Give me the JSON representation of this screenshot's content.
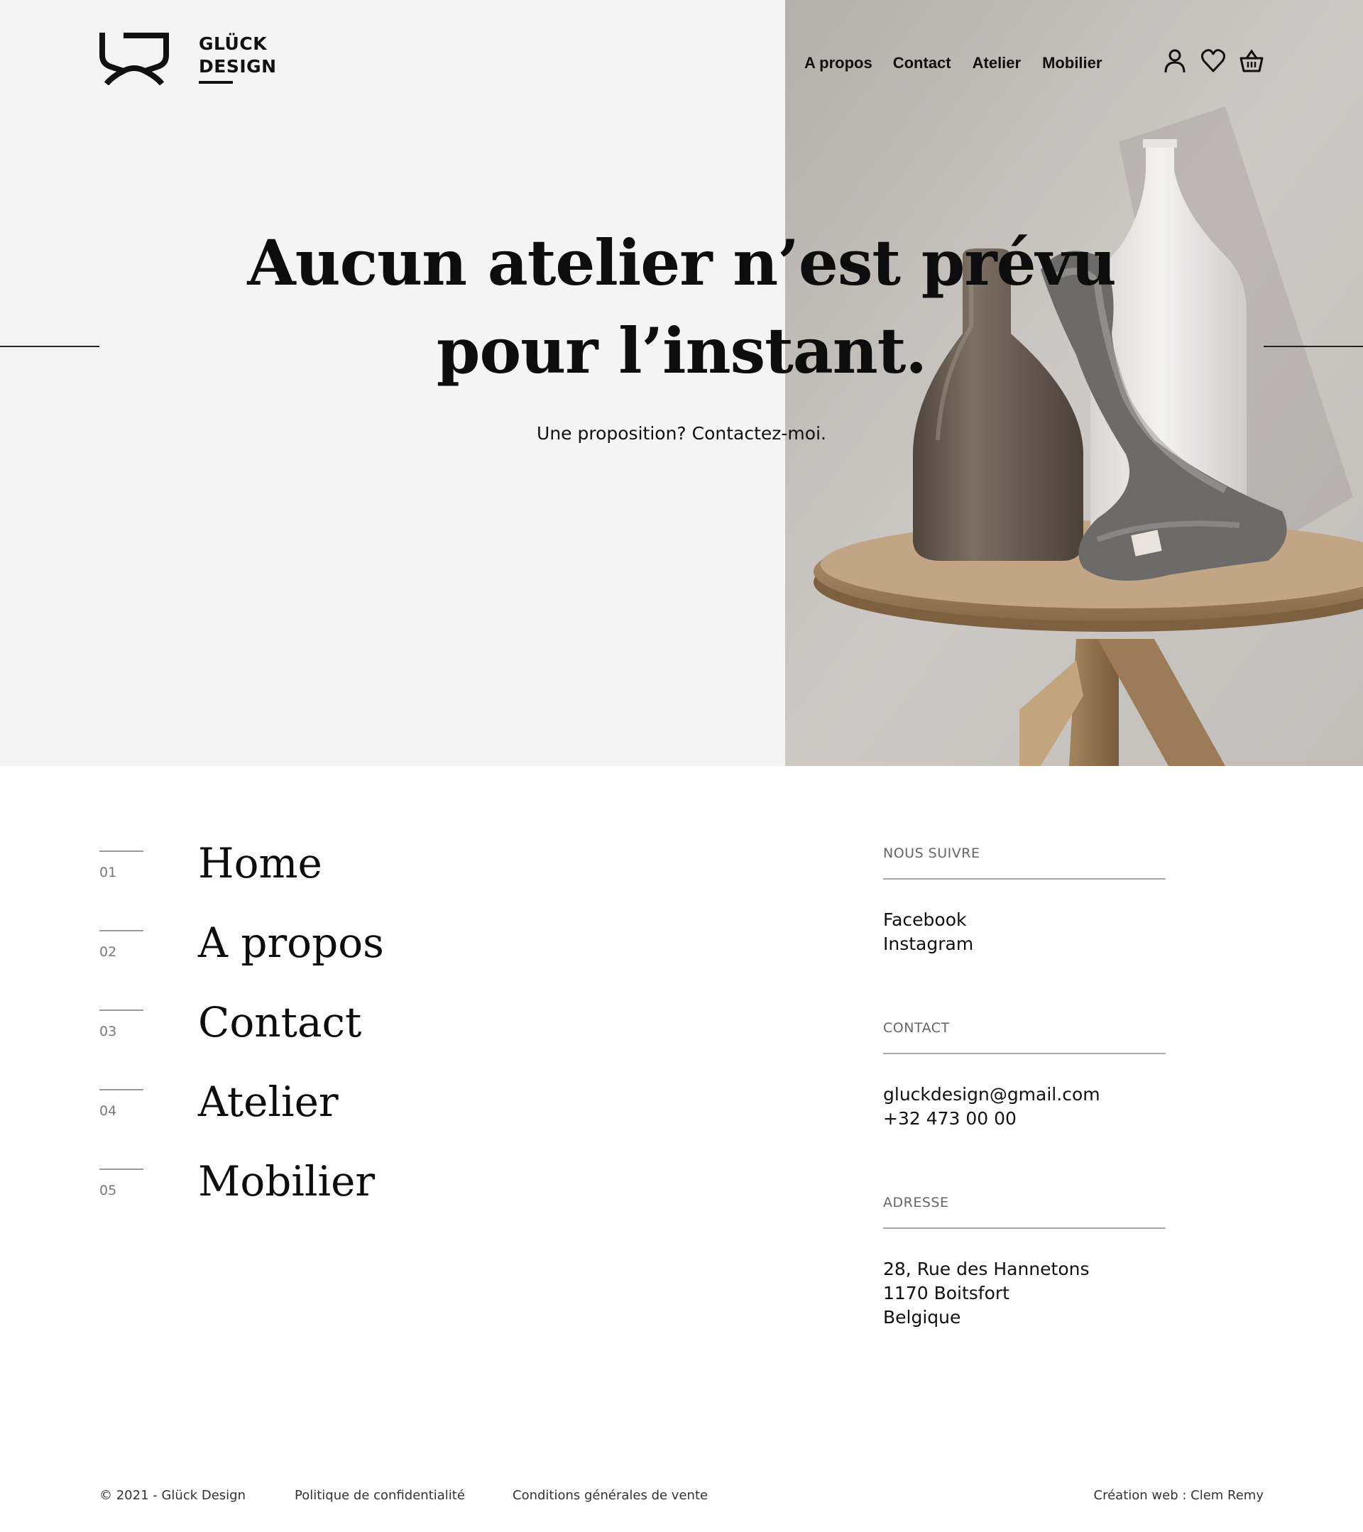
{
  "brand": {
    "line1": "GLÜCK",
    "line2": "DESIGN"
  },
  "header": {
    "nav": [
      {
        "label": "A propos"
      },
      {
        "label": "Contact"
      },
      {
        "label": "Atelier"
      },
      {
        "label": "Mobilier"
      }
    ],
    "icons": [
      "user-icon",
      "heart-icon",
      "basket-icon"
    ]
  },
  "hero": {
    "title_line1": "Aucun atelier n’est prévu",
    "title_line2": "pour l’instant.",
    "subtitle": "Une proposition? Contactez-moi."
  },
  "menu": [
    {
      "num": "01",
      "label": "Home"
    },
    {
      "num": "02",
      "label": "A propos"
    },
    {
      "num": "03",
      "label": "Contact"
    },
    {
      "num": "04",
      "label": "Atelier"
    },
    {
      "num": "05",
      "label": "Mobilier"
    }
  ],
  "follow": {
    "heading": "NOUS SUIVRE",
    "links": [
      "Facebook",
      "Instagram"
    ]
  },
  "contact": {
    "heading": "CONTACT",
    "email": "gluckdesign@gmail.com",
    "phone": "+32 473 00 00"
  },
  "address": {
    "heading": "ADRESSE",
    "line1": "28, Rue des Hannetons",
    "line2": "1170 Boitsfort",
    "line3": "Belgique"
  },
  "footer": {
    "copyright": "© 2021 - Glück Design",
    "privacy": "Politique de confidentialité",
    "terms": "Conditions générales de vente",
    "credit": "Création web : Clem Remy"
  },
  "colors": {
    "hero_bg": "#f4f4f4",
    "text": "#111111"
  }
}
